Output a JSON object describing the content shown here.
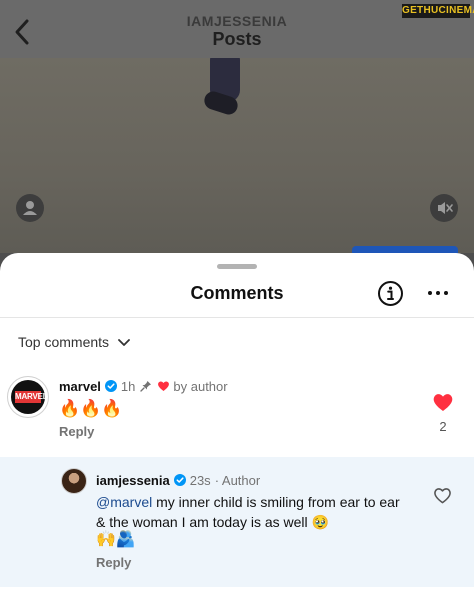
{
  "header": {
    "account_name": "IAMJESSENIA",
    "title": "Posts",
    "back_icon": "chevron-left-icon"
  },
  "watermark": "GETHUCINEMA",
  "sheet": {
    "title": "Comments",
    "info_icon": "info-icon",
    "more_icon": "ellipsis-icon",
    "sort_label": "Top comments"
  },
  "comments": [
    {
      "username": "marvel",
      "avatar_text": "MARVEL",
      "time": "1h",
      "pinned": true,
      "liked_by_author_label": "by author",
      "text": "🔥🔥🔥",
      "reply_label": "Reply",
      "like_count": "2",
      "liked": true
    }
  ],
  "reply": {
    "username": "iamjessenia",
    "time": "23s",
    "author_tag": "· Author",
    "mention": "@marvel",
    "text": " my inner child is smiling from ear to ear & the woman I am today is as well 🥹",
    "emoji_line": "🙌🫂",
    "reply_label": "Reply"
  },
  "colors": {
    "heart_red": "#ff3040",
    "verified_blue": "#0095f6",
    "mention_blue": "#1c4b8f",
    "reply_highlight": "#eef5fb"
  }
}
